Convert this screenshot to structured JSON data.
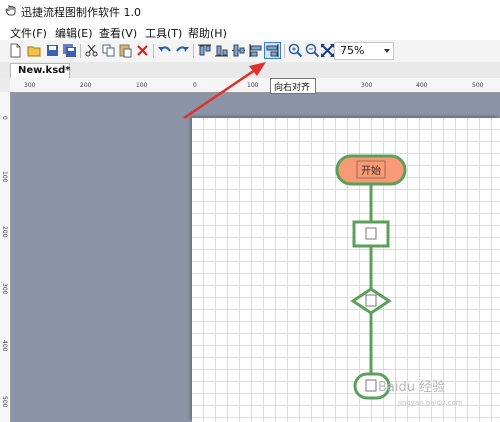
{
  "window": {
    "title": "迅捷流程图制作软件 1.0",
    "icon": "app-hand-icon"
  },
  "menu": [
    {
      "label": "文件(F)"
    },
    {
      "label": "编辑(E)"
    },
    {
      "label": "查看(V)"
    },
    {
      "label": "工具(T)"
    },
    {
      "label": "帮助(H)"
    }
  ],
  "toolbar": {
    "buttons": [
      "new-doc-icon",
      "open-folder-icon",
      "save-icon",
      "save-all-icon",
      "cut-icon",
      "copy-icon",
      "paste-icon",
      "delete-icon",
      "undo-icon",
      "redo-icon",
      "align-top-icon",
      "align-bottom-icon",
      "align-center-icon",
      "align-left-icon",
      "align-right-icon",
      "zoom-in-icon",
      "zoom-out-icon",
      "fit-icon"
    ],
    "active": "align-right-icon",
    "zoom": "75%"
  },
  "tooltip": "向右对齐",
  "tab": {
    "label": "New.ksd*"
  },
  "ruler": {
    "top_labels": [
      "300",
      "200",
      "100",
      "0",
      "100",
      "200",
      "300",
      "400",
      "500"
    ],
    "left_labels": [
      "0",
      "100",
      "200",
      "300",
      "400",
      "500"
    ]
  },
  "flowchart": {
    "start_label": "开始"
  },
  "watermark": {
    "text": "Baidu 经验",
    "sub": "jingyan.baidu.com"
  },
  "colors": {
    "workspace": "#8c95a8",
    "shape_stroke": "#5aa05a",
    "start_fill": "#f79a76",
    "annotation_arrow": "#e0302a",
    "active_button": "#3a7fd0"
  }
}
